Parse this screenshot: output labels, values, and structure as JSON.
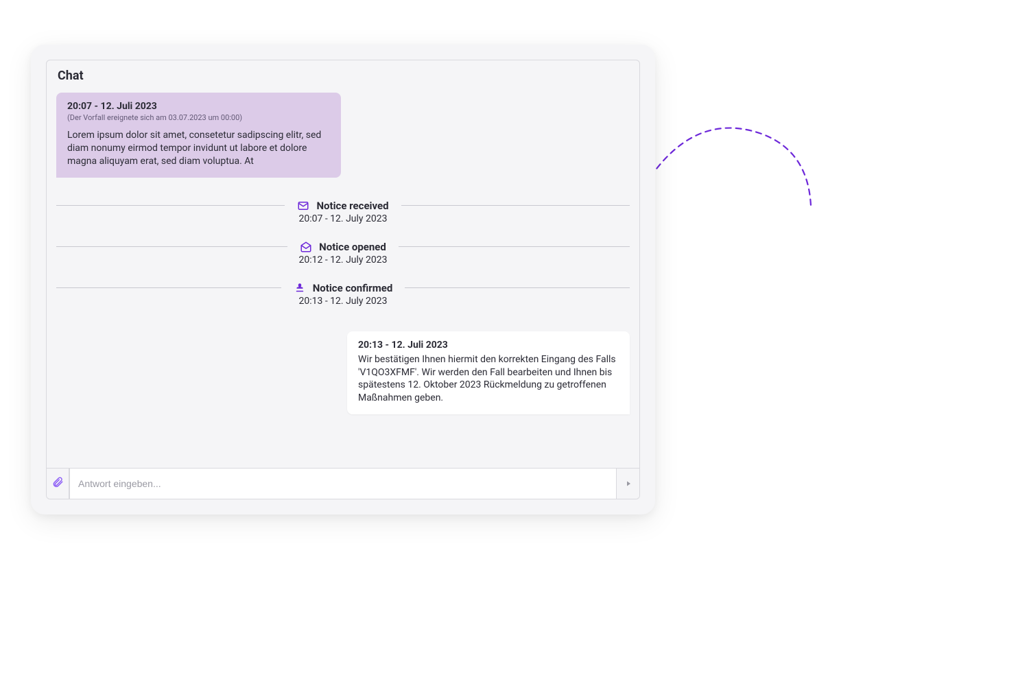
{
  "colors": {
    "accent": "#6d28d9",
    "bubble_left": "#dccbe8",
    "bubble_right": "#ffffff",
    "card_bg": "#f5f5f7"
  },
  "header": {
    "title": "Chat"
  },
  "messages": {
    "left": {
      "timestamp": "20:07 - 12. Juli 2023",
      "note": "(Der Vorfall ereignete sich am 03.07.2023 um 00:00)",
      "body": "Lorem ipsum dolor sit amet, consetetur sadipscing elitr, sed diam nonumy eirmod tempor invidunt ut labore et dolore magna aliquyam erat, sed diam voluptua. At"
    },
    "right": {
      "timestamp": "20:13 - 12. Juli 2023",
      "body": "Wir bestätigen Ihnen hiermit den korrekten Eingang des Falls 'V1QO3XFMF'. Wir werden den Fall bearbeiten und Ihnen bis spätestens 12. Oktober 2023 Rückmeldung zu getroffenen Maßnahmen geben."
    }
  },
  "status": [
    {
      "icon": "mail-closed-icon",
      "title": "Notice received",
      "time": "20:07 - 12. July 2023"
    },
    {
      "icon": "mail-open-icon",
      "title": "Notice opened",
      "time": "20:12 - 12. July 2023"
    },
    {
      "icon": "stamp-icon",
      "title": "Notice confirmed",
      "time": "20:13 - 12. July 2023"
    }
  ],
  "input": {
    "placeholder": "Antwort eingeben..."
  }
}
